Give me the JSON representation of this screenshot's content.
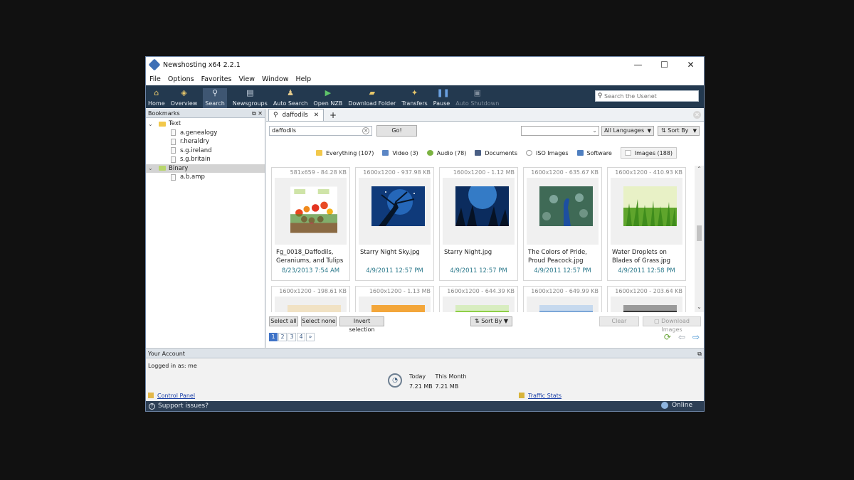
{
  "window": {
    "title": "Newshosting x64 2.2.1",
    "controls": [
      "—",
      "☐",
      "✕"
    ]
  },
  "menu": [
    "File",
    "Options",
    "Favorites",
    "View",
    "Window",
    "Help"
  ],
  "toolbar": {
    "buttons": [
      {
        "label": "Home",
        "icon": "home-icon"
      },
      {
        "label": "Overview",
        "icon": "overview-icon"
      },
      {
        "label": "Search",
        "icon": "search-icon"
      },
      {
        "label": "Newsgroups",
        "icon": "newsgroups-icon"
      },
      {
        "label": "Auto Search",
        "icon": "auto-search-icon"
      },
      {
        "label": "Open NZB",
        "icon": "open-nzb-icon"
      },
      {
        "label": "Download Folder",
        "icon": "download-folder-icon"
      },
      {
        "label": "Transfers",
        "icon": "transfers-icon"
      },
      {
        "label": "Pause",
        "icon": "pause-icon"
      },
      {
        "label": "Auto Shutdown",
        "icon": "auto-shutdown-icon"
      }
    ],
    "search_placeholder": "Search the Usenet"
  },
  "bookmarks": {
    "title": "Bookmarks",
    "tree": [
      {
        "label": "Text",
        "type": "folder"
      },
      {
        "label": "a.genealogy",
        "type": "doc"
      },
      {
        "label": "r.heraldry",
        "type": "doc"
      },
      {
        "label": "s.g.ireland",
        "type": "doc"
      },
      {
        "label": "s.g.britain",
        "type": "doc"
      },
      {
        "label": "Binary",
        "type": "folder"
      },
      {
        "label": "a.b.amp",
        "type": "doc"
      }
    ]
  },
  "search": {
    "tab_label": "daffodils",
    "query": "daffodils",
    "go_label": "Go!",
    "language": "All Languages",
    "sort_label": "Sort By"
  },
  "filters": [
    {
      "label": "Everything (107)",
      "color": "#f2c84b"
    },
    {
      "label": "Video (3)",
      "color": "#5b86c5"
    },
    {
      "label": "Audio (78)",
      "color": "#7cb342"
    },
    {
      "label": "Documents",
      "color": "#4a5f85"
    },
    {
      "label": "ISO Images",
      "color": "#9a9a9a"
    },
    {
      "label": "Software",
      "color": "#4f7fc0"
    },
    {
      "label": "Images (188)",
      "color": "#c7c7c7"
    }
  ],
  "results": [
    {
      "meta": "581x659 - 84.28 KB",
      "name": "Fg_0018_Daffodils, Geraniums, and Tulips",
      "date": "8/23/2013 7:54 AM"
    },
    {
      "meta": "1600x1200 - 937.98 KB",
      "name": "Starry Night Sky.jpg",
      "date": "4/9/2011 12:57 PM"
    },
    {
      "meta": "1600x1200 - 1.12 MB",
      "name": "Starry Night.jpg",
      "date": "4/9/2011 12:57 PM"
    },
    {
      "meta": "1600x1200 - 635.67 KB",
      "name": "The Colors of Pride, Proud Peacock.jpg",
      "date": "4/9/2011 12:57 PM"
    },
    {
      "meta": "1600x1200 - 410.93 KB",
      "name": "Water Droplets on Blades of Grass.jpg",
      "date": "4/9/2011 12:58 PM"
    },
    {
      "meta": "1600x1200 - 198.61 KB",
      "name": "",
      "date": ""
    },
    {
      "meta": "1600x1200 - 1.13 MB",
      "name": "",
      "date": ""
    },
    {
      "meta": "1600x1200 - 644.39 KB",
      "name": "",
      "date": ""
    },
    {
      "meta": "1600x1200 - 649.99 KB",
      "name": "",
      "date": ""
    },
    {
      "meta": "1600x1200 - 203.64 KB",
      "name": "",
      "date": ""
    }
  ],
  "actions": {
    "select_all": "Select all",
    "select_none": "Select none",
    "invert": "Invert selection",
    "sort_by": "Sort By",
    "clear": "Clear",
    "download": "Download Images"
  },
  "pager": [
    "1",
    "2",
    "3",
    "4",
    "»"
  ],
  "account": {
    "title": "Your Account",
    "logged_in": "Logged in as: me",
    "today_label": "Today",
    "month_label": "This Month",
    "today_value": "7.21 MB",
    "month_value": "7.21 MB",
    "control_panel": "Control Panel",
    "traffic_stats": "Traffic Stats"
  },
  "status": {
    "support": "Support issues?",
    "online": "Online"
  }
}
